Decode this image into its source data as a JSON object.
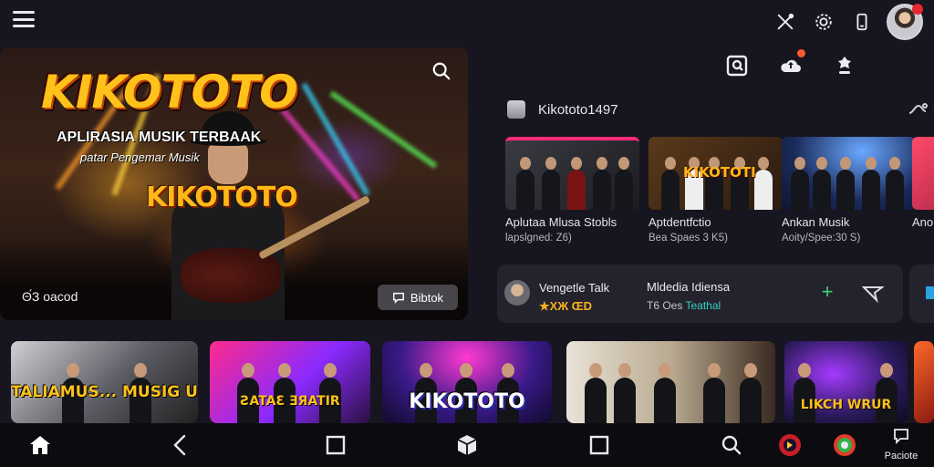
{
  "header": {
    "icons": [
      "menu-icon",
      "tools-icon",
      "settings-icon",
      "phone-icon",
      "avatar"
    ]
  },
  "hero": {
    "logo": "KIKOTOTO",
    "tagline": "APLIRASIA MUSIK TERBAAK",
    "tagline2": "patar Pengemar Musik",
    "brand_text": "KIKOTOTO",
    "caption": "Θ́З oacod",
    "pill_label": "Bibtok"
  },
  "quick_actions": [
    "scan-icon",
    "cloud-upload-icon",
    "bell-pin-icon"
  ],
  "section": {
    "title": "Kikototo1497"
  },
  "cards": [
    {
      "title": "Aplutaa Mlusa Stobls",
      "subtitle": "lapslgned: Z6)"
    },
    {
      "title": "Aptdentfctio",
      "subtitle": "Bea Spaes 3 K5)"
    },
    {
      "title": "Ankan Musik",
      "subtitle": "Aoity/Spee:30 S)"
    },
    {
      "title": "Ano",
      "subtitle": ""
    }
  ],
  "row_panel": {
    "name": "Vengetle Talk",
    "rating": "★XЖ ŒD",
    "title": "Mldedia Idiensa",
    "subtitle_prefix": "T6 Oes ",
    "subtitle_accent": "Teathal"
  },
  "tiles": [
    {
      "label": "TALIAMUS... MUSIG UOS"
    },
    {
      "label": "ƧATAƐ ƎЯATIR"
    },
    {
      "label": "KIKOTOTO"
    },
    {
      "label": ""
    },
    {
      "label": "LIKCH WRUR"
    }
  ],
  "navbar": {
    "items": [
      "home-icon",
      "back-icon",
      "square-icon",
      "cube-icon",
      "square-icon",
      "search-icon",
      "app-icon-1",
      "app-icon-2"
    ],
    "last_label": "Paciote"
  },
  "colors": {
    "background": "#17151f",
    "accent_gold": "#ffc21a",
    "accent_green": "#3fd37b",
    "accent_teal": "#33d3c0",
    "notification_red": "#e5262e"
  }
}
